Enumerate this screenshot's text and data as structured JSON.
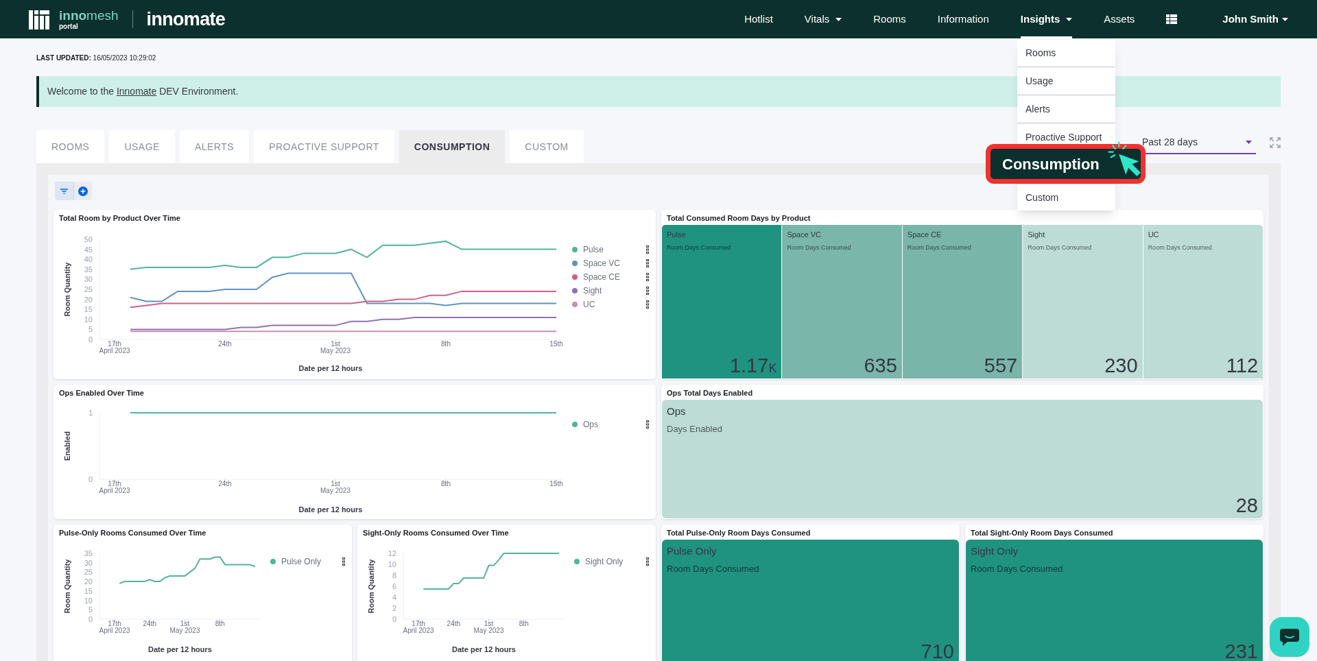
{
  "header": {
    "logo": {
      "brand": "**inno**mesh",
      "sub": "portal",
      "product": "innomate"
    },
    "nav": [
      {
        "label": "Hotlist",
        "selected": false,
        "dropdown": false
      },
      {
        "label": "Vitals",
        "selected": false,
        "dropdown": true
      },
      {
        "label": "Rooms",
        "selected": false,
        "dropdown": false
      },
      {
        "label": "Information",
        "selected": false,
        "dropdown": false
      },
      {
        "label": "Insights",
        "selected": true,
        "dropdown": true
      },
      {
        "label": "Assets",
        "selected": false,
        "dropdown": false
      }
    ],
    "user": {
      "name": "John Smith"
    }
  },
  "insights_menu": {
    "items": [
      {
        "label": "Rooms",
        "kind": "item"
      },
      {
        "label": "Usage",
        "kind": "item"
      },
      {
        "label": "Alerts",
        "kind": "item"
      },
      {
        "label": "Proactive Support",
        "kind": "item"
      },
      {
        "label": "Consumption",
        "kind": "callout"
      },
      {
        "label": "Custom",
        "kind": "item"
      }
    ]
  },
  "last_updated": "**LAST UPDATED:** 16/05/2023 10:29:02",
  "banner": {
    "before": "Welcome to the",
    "link": "Innomate",
    "after": "DEV Environment."
  },
  "tabs": [
    {
      "label": "ROOMS",
      "selected": false
    },
    {
      "label": "USAGE",
      "selected": false
    },
    {
      "label": "ALERTS",
      "selected": false
    },
    {
      "label": "PROACTIVE SUPPORT",
      "selected": false
    },
    {
      "label": "CONSUMPTION",
      "selected": true
    },
    {
      "label": "CUSTOM",
      "selected": false
    }
  ],
  "time_range": {
    "value": "Past 28 days"
  },
  "panels": [
    {
      "kind": "line_chart",
      "title": "Total Room by Product Over Time",
      "chart_data": {
        "type": "line",
        "xlabel": "Date per 12 hours",
        "ylabel": "Room Quantity",
        "categories": [
          "17th April 2023",
          null,
          null,
          null,
          null,
          null,
          null,
          "24th",
          null,
          null,
          null,
          null,
          null,
          null,
          "1st May 2023",
          null,
          null,
          null,
          null,
          null,
          null,
          "8th",
          null,
          null,
          null,
          null,
          null,
          null,
          "15th"
        ],
        "ylim": [
          0,
          50
        ],
        "yticks": [
          0,
          5,
          10,
          15,
          20,
          25,
          30,
          35,
          40,
          45,
          50
        ],
        "series": [
          {
            "name": "Pulse",
            "color": "#54b399",
            "values": [
              null,
              35,
              36,
              36,
              36,
              36,
              36,
              37,
              36,
              36,
              41,
              41,
              43,
              43,
              43,
              45,
              41,
              47,
              47,
              47,
              48,
              49,
              45,
              45,
              45,
              45,
              45,
              45,
              45
            ]
          },
          {
            "name": "Space VC",
            "color": "#6092c0",
            "values": [
              null,
              21,
              19,
              19,
              24,
              24,
              24,
              25,
              25,
              25,
              31,
              33,
              33,
              33,
              33,
              33,
              18,
              18,
              18,
              18,
              18,
              17,
              18,
              18,
              18,
              18,
              18,
              18,
              18
            ]
          },
          {
            "name": "Space CE",
            "color": "#d36086",
            "values": [
              null,
              16,
              17,
              18,
              18,
              18,
              18,
              18,
              18,
              18,
              18,
              18,
              18,
              18,
              18,
              18,
              19,
              19,
              20,
              20,
              22,
              22,
              24,
              24,
              24,
              24,
              24,
              24,
              24
            ]
          },
          {
            "name": "Sight",
            "color": "#9170b8",
            "values": [
              null,
              5,
              5,
              5,
              5,
              5,
              5,
              5,
              6,
              6,
              7,
              7,
              7,
              7,
              7,
              9,
              9,
              10,
              10,
              11,
              11,
              11,
              11,
              11,
              11,
              11,
              11,
              11,
              11
            ]
          },
          {
            "name": "UC",
            "color": "#ca8eae",
            "values": [
              null,
              4,
              4,
              4,
              4,
              4,
              4,
              4,
              4,
              4,
              4,
              4,
              4,
              4,
              4,
              4,
              4,
              4,
              4,
              4,
              4,
              4,
              4,
              4,
              4,
              4,
              4,
              4,
              4
            ]
          }
        ]
      }
    },
    {
      "kind": "metrics",
      "title": "Total Consumed Room Days by Product",
      "tiles": [
        {
          "label": "Pulse",
          "caption": "Room Days Consumed",
          "value": "1.17",
          "unit": "K",
          "color": "#209280"
        },
        {
          "label": "Space VC",
          "caption": "Room Days Consumed",
          "value": "635",
          "color": "#7ab6aa"
        },
        {
          "label": "Space CE",
          "caption": "Room Days Consumed",
          "value": "557",
          "color": "#79b5a8"
        },
        {
          "label": "Sight",
          "caption": "Room Days Consumed",
          "value": "230",
          "color": "#bcdcd5"
        },
        {
          "label": "UC",
          "caption": "Room Days Consumed",
          "value": "112",
          "color": "#bcdcd5"
        }
      ]
    },
    {
      "kind": "line_chart",
      "title": "Ops Enabled Over Time",
      "chart_data": {
        "type": "line",
        "xlabel": "Date per 12 hours",
        "ylabel": "Enabled",
        "categories": [
          "17th April 2023",
          null,
          null,
          null,
          null,
          null,
          null,
          "24th",
          null,
          null,
          null,
          null,
          null,
          null,
          "1st May 2023",
          null,
          null,
          null,
          null,
          null,
          null,
          "8th",
          null,
          null,
          null,
          null,
          null,
          null,
          "15th"
        ],
        "ylim": [
          0,
          1
        ],
        "yticks": [
          0,
          1
        ],
        "series": [
          {
            "name": "Ops",
            "color": "#54b399",
            "values": [
              null,
              1,
              1,
              1,
              1,
              1,
              1,
              1,
              1,
              1,
              1,
              1,
              1,
              1,
              1,
              1,
              1,
              1,
              1,
              1,
              1,
              1,
              1,
              1,
              1,
              1,
              1,
              1,
              1
            ]
          }
        ]
      }
    },
    {
      "kind": "metrics",
      "title": "Ops Total Days Enabled",
      "tiles": [
        {
          "label": "Ops",
          "caption": "Days Enabled",
          "value": "28",
          "color": "#bcdcd5"
        }
      ]
    },
    {
      "kind": "line_chart",
      "title": "Pulse-Only Rooms Consumed Over Time",
      "chart_data": {
        "type": "line",
        "xlabel": "Date per 12 hours",
        "ylabel": "Room Quantity",
        "categories": [
          "17th April 2023",
          null,
          null,
          null,
          null,
          null,
          null,
          "24th",
          null,
          null,
          null,
          null,
          null,
          null,
          "1st May 2023",
          null,
          null,
          null,
          null,
          null,
          null,
          "8th",
          null,
          null,
          null,
          null,
          null,
          null,
          null
        ],
        "ylim": [
          0,
          35
        ],
        "yticks": [
          0,
          5,
          10,
          15,
          20,
          25,
          30,
          35
        ],
        "series": [
          {
            "name": "Pulse Only",
            "color": "#54b399",
            "values": [
              null,
              19,
              20,
              20,
              20,
              20,
              20,
              21,
              20,
              20,
              22,
              23,
              23,
              23,
              23,
              25,
              27,
              32,
              32,
              32,
              33,
              33,
              29,
              29,
              29,
              29,
              29,
              29,
              28
            ]
          }
        ]
      }
    },
    {
      "kind": "line_chart",
      "title": "Sight-Only Rooms Consumed Over Time",
      "chart_data": {
        "type": "line",
        "xlabel": "Date per 12 hours",
        "ylabel": "Room Quantity",
        "categories": [
          "17th April 2023",
          null,
          null,
          null,
          null,
          null,
          null,
          "24th",
          null,
          null,
          null,
          null,
          null,
          null,
          "1st May 2023",
          null,
          null,
          null,
          null,
          null,
          null,
          "8th",
          null,
          null,
          null,
          null,
          null,
          null,
          null
        ],
        "ylim": [
          0,
          12
        ],
        "yticks": [
          0,
          2,
          4,
          6,
          8,
          10,
          12
        ],
        "series": [
          {
            "name": "Sight Only",
            "color": "#54b399",
            "values": [
              null,
              5.5,
              5.5,
              5.5,
              5.5,
              5.5,
              5.5,
              6.5,
              6.5,
              7.5,
              7.5,
              7.5,
              7.5,
              7.5,
              9.8,
              9.8,
              10.8,
              12,
              12,
              12,
              12,
              12,
              12,
              12,
              12,
              12,
              12,
              12,
              12
            ]
          }
        ]
      }
    },
    {
      "kind": "metrics",
      "title": "Total Pulse-Only Room Days Consumed",
      "tiles": [
        {
          "label": "Pulse Only",
          "caption": "Room Days Consumed",
          "value": "710",
          "color": "#209280"
        }
      ]
    },
    {
      "kind": "metrics",
      "title": "Total Sight-Only Room Days Consumed",
      "tiles": [
        {
          "label": "Sight Only",
          "caption": "Room Days Consumed",
          "value": "231",
          "color": "#209280"
        }
      ]
    }
  ]
}
